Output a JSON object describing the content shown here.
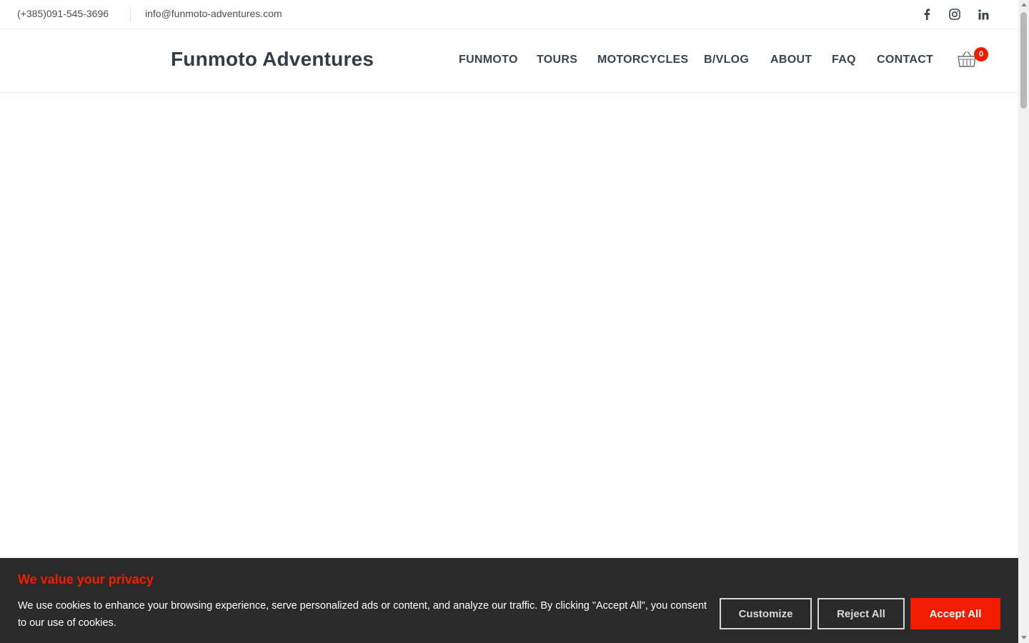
{
  "topbar": {
    "phone": "(+385)091-545-3696",
    "email": "info@funmoto-adventures.com",
    "social": [
      {
        "name": "facebook-icon"
      },
      {
        "name": "instagram-icon"
      },
      {
        "name": "linkedin-icon"
      }
    ]
  },
  "header": {
    "logo": "Funmoto Adventures",
    "nav": [
      "FUNMOTO",
      "TOURS",
      "MOTORCYCLES",
      "B/VLOG",
      "ABOUT",
      "FAQ",
      "CONTACT"
    ],
    "cart_count": "0"
  },
  "cookie_banner": {
    "title": "We value your privacy",
    "text": "We use cookies to enhance your browsing experience, serve personalized ads or content, and analyze our traffic. By clicking \"Accept All\", you consent to our use of cookies.",
    "customize_label": "Customize",
    "reject_label": "Reject All",
    "accept_label": "Accept All"
  },
  "colors": {
    "accent": "#f21d00",
    "banner_bg": "#2a2a2a",
    "text_dark": "#333d47"
  }
}
